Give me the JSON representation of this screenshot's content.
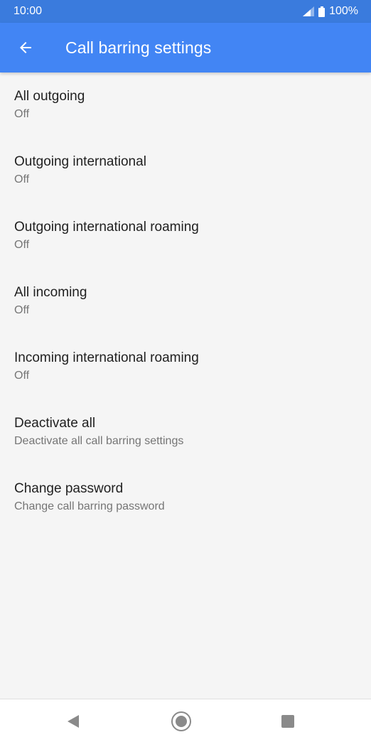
{
  "status_bar": {
    "time": "10:00",
    "battery": "100%",
    "icons": [
      "signal-icon",
      "battery-icon"
    ]
  },
  "app_bar": {
    "title": "Call barring settings",
    "back_icon": "arrow-back-icon"
  },
  "items": [
    {
      "title": "All outgoing",
      "subtitle": "Off"
    },
    {
      "title": "Outgoing international",
      "subtitle": "Off"
    },
    {
      "title": "Outgoing international roaming",
      "subtitle": "Off"
    },
    {
      "title": "All incoming",
      "subtitle": "Off"
    },
    {
      "title": "Incoming international roaming",
      "subtitle": "Off"
    },
    {
      "title": "Deactivate all",
      "subtitle": "Deactivate all call barring settings"
    },
    {
      "title": "Change password",
      "subtitle": "Change call barring password"
    }
  ],
  "nav_bar": {
    "icons": [
      "nav-back-icon",
      "nav-home-icon",
      "nav-recents-icon"
    ]
  },
  "colors": {
    "status_bar": "#3a7bdd",
    "app_bar": "#4285f4",
    "background": "#f5f5f5",
    "title_text": "#212121",
    "subtitle_text": "#757575"
  }
}
